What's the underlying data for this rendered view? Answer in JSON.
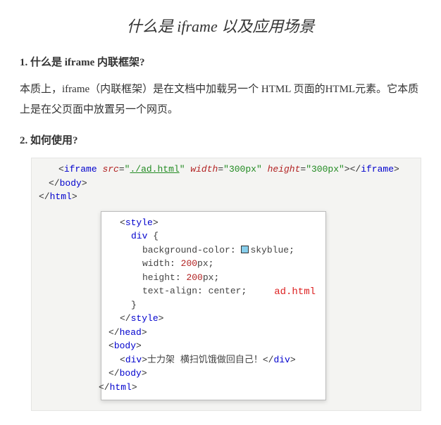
{
  "title": "什么是 iframe 以及应用场景",
  "h1": "1. 什么是 iframe 内联框架?",
  "para1": "本质上，iframe（内联框架）是在文档中加载另一个 HTML 页面的HTML元素。它本质上是在父页面中放置另一个网页。",
  "h2": "2. 如何使用?",
  "outer": {
    "iframe_lt": "<",
    "iframe_tag": "iframe",
    "src_attr": "src",
    "src_eq": "=",
    "src_q1": "\"",
    "src_val": "./ad.html",
    "src_q2": "\"",
    "width_attr": "width",
    "width_eq": "=",
    "width_val": "\"300px\"",
    "height_attr": "height",
    "height_eq": "=",
    "height_val": "\"300px\"",
    "iframe_close": "></",
    "iframe_tag2": "iframe",
    "gt": ">",
    "body_close": "</",
    "body_tag": "body",
    "html_close": "</",
    "html_tag": "html"
  },
  "inner": {
    "style_open_lt": "<",
    "style_tag": "style",
    "gt": ">",
    "sel": "div",
    "brace_open": "{",
    "bg_prop": "background-color",
    "colon": ":",
    "sky_color": "#87ceeb",
    "sky_val": "skyblue",
    "semi": ";",
    "width_prop": "width",
    "width_val": "200",
    "px": "px",
    "height_prop": "height",
    "height_val": "200",
    "ta_prop": "text-align",
    "ta_val": "center",
    "brace_close": "}",
    "style_close_lt": "</",
    "style_tag2": "style",
    "head_close_lt": "</",
    "head_tag": "head",
    "body_open_lt": "<",
    "body_tag": "body",
    "div_open_lt": "<",
    "div_tag": "div",
    "div_text": "士力架 横扫饥饿做回自己！",
    "div_close_lt": "</",
    "body_close_lt": "</",
    "html_close_lt": "</",
    "html_tag": "html",
    "label": "ad.html"
  }
}
